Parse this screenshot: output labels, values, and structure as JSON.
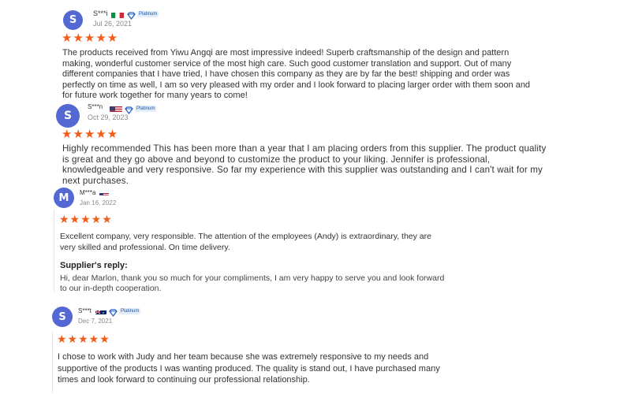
{
  "reviews": [
    {
      "avatar_letter": "S",
      "name": "S***i",
      "flag": "italy",
      "badge": "Platinum",
      "date": "Jul 26, 2021",
      "stars": "★★★★★",
      "rating": 5,
      "text": "The products received from Yiwu Angqi are most impressive indeed! Superb craftsmanship of the design and pattern making, wonderful customer service of the most high care. Such good customer translation and support. Out of many different companies that I have tried, I have chosen this company as they are by far the best! shipping and order was perfectly on time as well, I am so very pleased with my order and I look forward to placing larger order with them soon and for future work together for many years to come!"
    },
    {
      "avatar_letter": "S",
      "name": "S***n",
      "flag": "usa",
      "badge": "Platinum",
      "date": "Oct 29, 2023",
      "stars": "★★★★★",
      "rating": 5,
      "text": "Highly recommended This has been more than a year that I am placing orders from this supplier. The product quality is great and they go above and beyond to customize the product to your liking. Jennifer is professional, knowledgeable and very responsive. So far my experience with this supplier was outstanding and I can't wait for my next purchases."
    },
    {
      "avatar_letter": "M",
      "name": "M***a",
      "flag": "usa",
      "date": "Jan 16, 2022",
      "stars": "★★★★★",
      "rating": 5,
      "text": "Excellent company, very responsible. The attention of the employees (Andy) is extraordinary, they are very skilled and professional. On time delivery.",
      "reply_title": "Supplier's reply:",
      "reply_text": "Hi, dear Marlon, thank you so much for your compliments, I am very happy to serve you and look forward to our in-depth cooperation."
    },
    {
      "avatar_letter": "S",
      "name": "S***t",
      "flag": "australia",
      "badge": "Platinum",
      "date": "Dec 7, 2021",
      "stars": "★★★★★",
      "rating": 5,
      "text": "I chose to work with Judy and her team because she was extremely responsive to my needs and supportive of the products I was wanting produced. The quality is stand out, I have purchased many times and look forward to continuing our professional relationship."
    }
  ],
  "colors": {
    "avatar": "#5468d4",
    "star": "#f25c1a",
    "badge_text": "#1a56a8"
  }
}
